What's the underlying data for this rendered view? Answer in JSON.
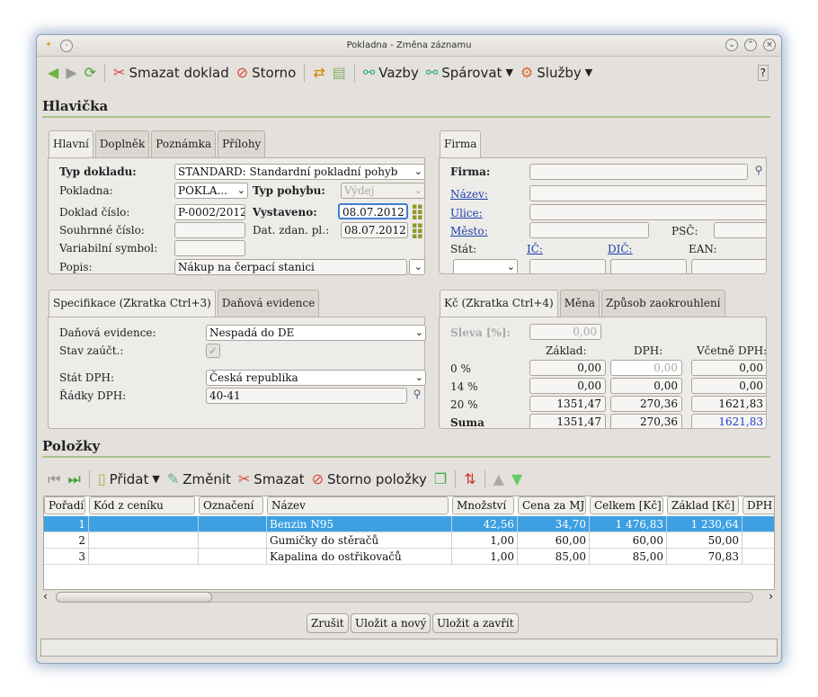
{
  "window": {
    "title": "Pokladna - Změna záznamu"
  },
  "toolbar": {
    "delete": "Smazat doklad",
    "cancel": "Storno",
    "links": "Vazby",
    "pair": "Spárovat",
    "services": "Služby"
  },
  "header": {
    "title": "Hlavička",
    "tabs": [
      "Hlavní",
      "Doplněk",
      "Poznámka",
      "Přílohy"
    ],
    "firm_tab": "Firma",
    "labels": {
      "doc_type": "Typ dokladu:",
      "cash": "Pokladna:",
      "move_type": "Typ pohybu:",
      "doc_no": "Doklad číslo:",
      "issued": "Vystaveno:",
      "summary_no": "Souhrnné číslo:",
      "tax_date": "Dat. zdan. pl.:",
      "var_symbol": "Variabilní symbol:",
      "desc": "Popis:"
    },
    "values": {
      "doc_type": "STANDARD: Standardní pokladní pohyb",
      "cash": "POKLA...",
      "move_type": "Výdej",
      "doc_no": "P-0002/2012",
      "issued": "08.07.2012",
      "summary_no": "",
      "tax_date": "08.07.2012",
      "var_symbol": "",
      "desc": "Nákup na čerpací stanici"
    },
    "firm_labels": {
      "firm": "Firma:",
      "name": "Název:",
      "street": "Ulice:",
      "city": "Město:",
      "psc": "PSČ:",
      "state": "Stát:",
      "ic": "IČ:",
      "dic": "DIČ:",
      "ean": "EAN:"
    }
  },
  "spec": {
    "tabs": [
      "Specifikace (Zkratka Ctrl+3)",
      "Daňová evidence"
    ],
    "labels": {
      "tax_evidence": "Daňová evidence:",
      "account_state": "Stav zaúčt.:",
      "vat_state": "Stát DPH:",
      "vat_rows": "Řádky DPH:"
    },
    "values": {
      "tax_evidence": "Nespadá do DE",
      "vat_state": "Česká republika",
      "vat_rows": "40-41"
    }
  },
  "currency": {
    "tabs": [
      "Kč (Zkratka Ctrl+4)",
      "Měna",
      "Způsob zaokrouhlení"
    ],
    "discount_label": "Sleva [%]:",
    "discount": "0,00",
    "cols": [
      "Základ:",
      "DPH:",
      "Včetně DPH:"
    ],
    "rows": [
      {
        "label": "0 %",
        "base": "0,00",
        "vat": "0,00",
        "total": "0,00"
      },
      {
        "label": "14 %",
        "base": "0,00",
        "vat": "0,00",
        "total": "0,00"
      },
      {
        "label": "20 %",
        "base": "1351,47",
        "vat": "270,36",
        "total": "1621,83"
      },
      {
        "label": "Suma",
        "base": "1351,47",
        "vat": "270,36",
        "total": "1621,83"
      }
    ]
  },
  "items": {
    "title": "Položky",
    "toolbar": {
      "add": "Přidat",
      "edit": "Změnit",
      "delete": "Smazat",
      "cancel": "Storno položky"
    },
    "columns": [
      "Pořadí",
      "Kód z ceníku",
      "Označení",
      "Název",
      "Množství",
      "Cena za MJ",
      "Celkem [Kč]",
      "Základ [Kč]",
      "DPH ["
    ],
    "rows": [
      {
        "order": "1",
        "code": "",
        "mark": "",
        "name": "Benzin N95",
        "qty": "42,56",
        "price": "34,70",
        "total": "1 476,83",
        "base": "1 230,64"
      },
      {
        "order": "2",
        "code": "",
        "mark": "",
        "name": "Gumičky do stěračů",
        "qty": "1,00",
        "price": "60,00",
        "total": "60,00",
        "base": "50,00"
      },
      {
        "order": "3",
        "code": "",
        "mark": "",
        "name": "Kapalina do ostřikovačů",
        "qty": "1,00",
        "price": "85,00",
        "total": "85,00",
        "base": "70,83"
      }
    ]
  },
  "buttons": {
    "cancel": "Zrušit",
    "save_new": "Uložit a nový",
    "save_close": "Uložit a zavřít"
  }
}
